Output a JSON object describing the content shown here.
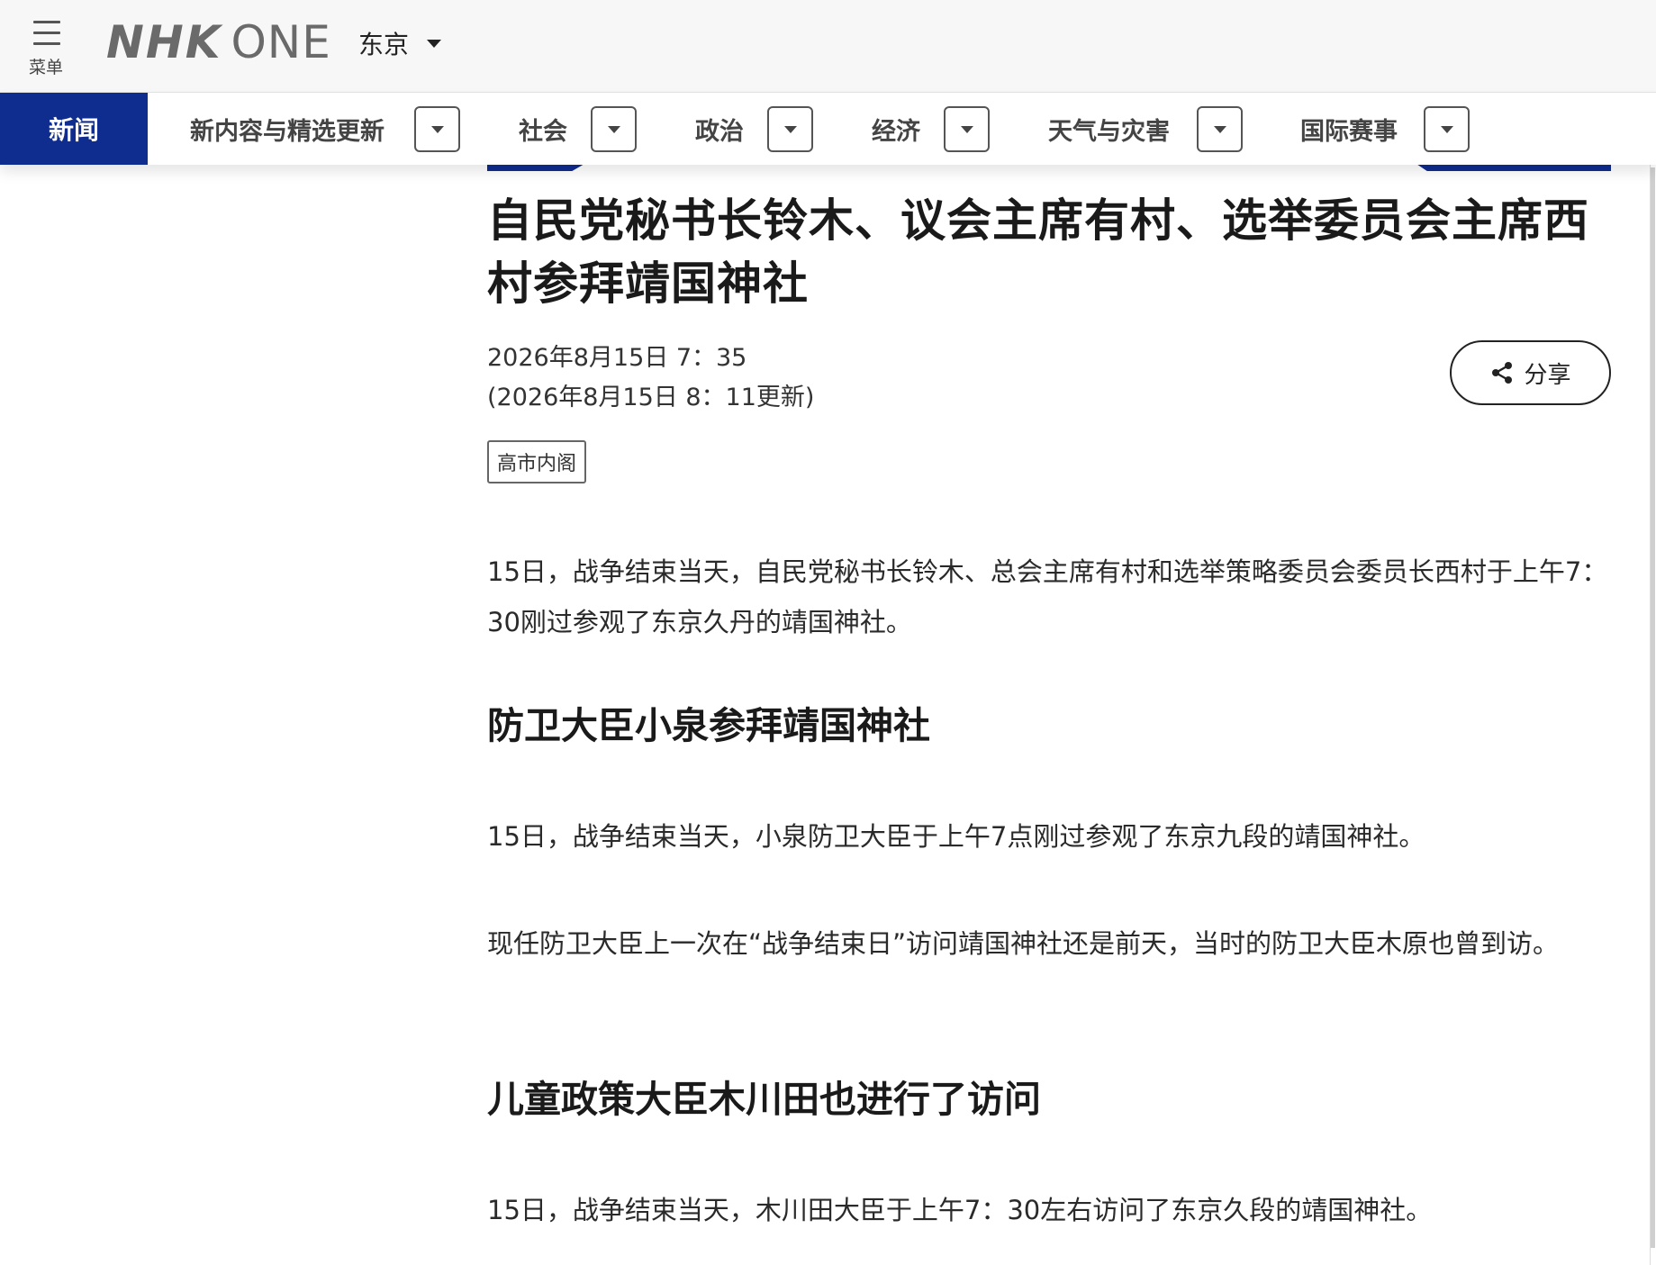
{
  "header": {
    "menu_label": "菜单",
    "logo_nhk": "NHK",
    "logo_one": "ONE",
    "region": "东京"
  },
  "nav": {
    "active": "新闻",
    "items": [
      {
        "label": "新内容与精选更新"
      },
      {
        "label": "社会"
      },
      {
        "label": "政治"
      },
      {
        "label": "经济"
      },
      {
        "label": "天气与灾害"
      },
      {
        "label": "国际赛事"
      }
    ]
  },
  "colors": {
    "brand_blue": "#0f2c8f",
    "header_bg": "#f7f7f7"
  },
  "article": {
    "headline": "自民党秘书长铃木、议会主席有村、选举委员会主席西村参拜靖国神社",
    "published": "2026年8月15日 7：35",
    "updated": "(2026年8月15日 8：11更新)",
    "share_label": "分享",
    "tag": "高市内阁",
    "blocks": [
      {
        "type": "para",
        "text": "15日，战争结束当天，自民党秘书长铃木、总会主席有村和选举策略委员会委员长西村于上午7：30刚过参观了东京久丹的靖国神社。"
      },
      {
        "type": "subhead",
        "text": "防卫大臣小泉参拜靖国神社"
      },
      {
        "type": "para",
        "text": "15日，战争结束当天，小泉防卫大臣于上午7点刚过参观了东京九段的靖国神社。"
      },
      {
        "type": "para",
        "text": "现任防卫大臣上一次在“战争结束日”访问靖国神社还是前天，当时的防卫大臣木原也曾到访。"
      },
      {
        "type": "subhead",
        "text": "儿童政策大臣木川田也进行了访问"
      },
      {
        "type": "para",
        "text": "15日，战争结束当天，木川田大臣于上午7：30左右访问了东京久段的靖国神社。"
      }
    ]
  },
  "icons": {
    "menu": "hamburger-icon",
    "region_caret": "caret-down-icon",
    "share": "share-icon"
  }
}
